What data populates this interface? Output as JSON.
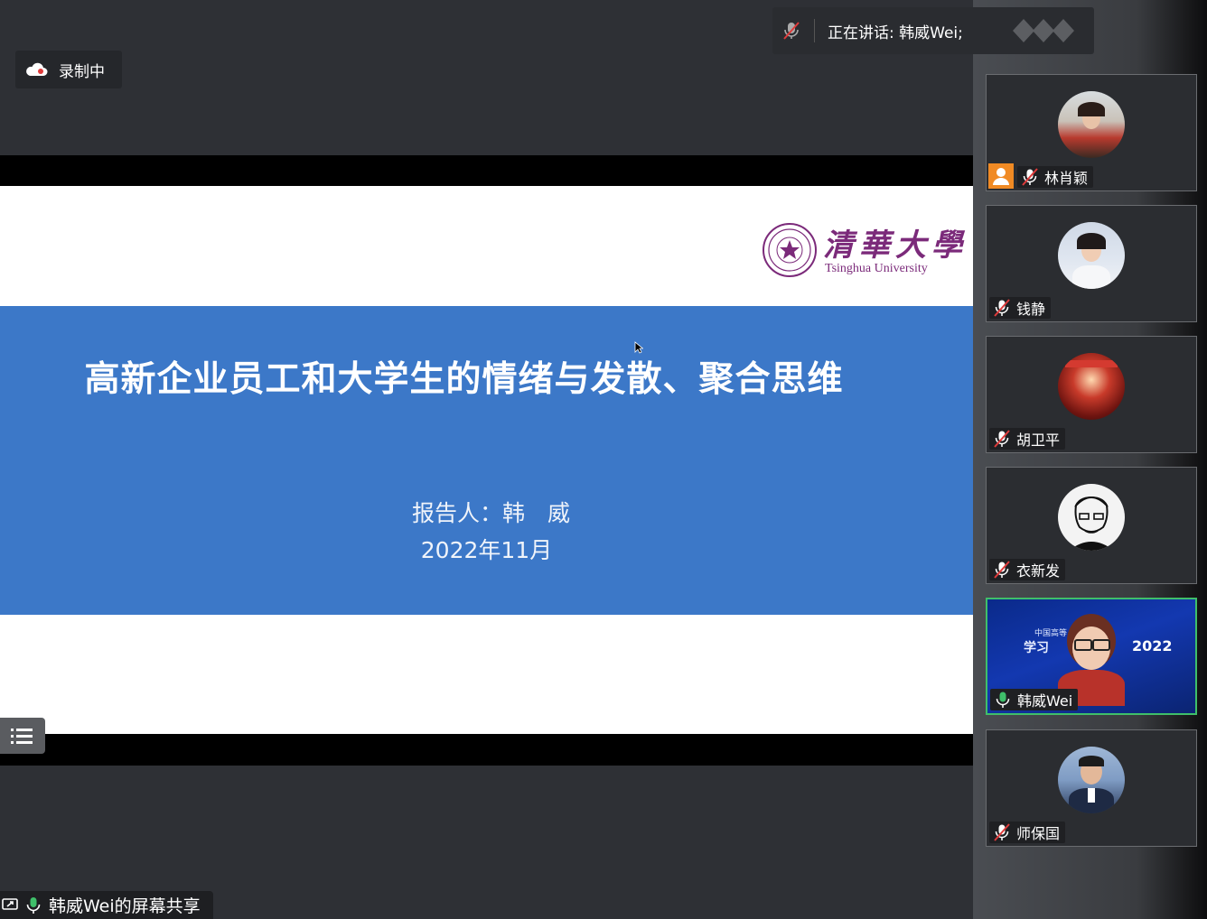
{
  "speaking": {
    "text": "正在讲话: 韩威Wei;"
  },
  "recording": {
    "label": "录制中"
  },
  "slide": {
    "logo_text": "清華大學",
    "logo_english": "Tsinghua University",
    "title": "高新企业员工和大学生的情绪与发散、聚合思维",
    "presenter": "报告人：韩　威",
    "date": "2022年11月"
  },
  "screen_share": {
    "label": "韩威Wei的屏幕共享"
  },
  "participants": [
    {
      "name": "林肖颖",
      "muted": true,
      "host": true
    },
    {
      "name": "钱静",
      "muted": true
    },
    {
      "name": "胡卫平",
      "muted": true
    },
    {
      "name": "衣新发",
      "muted": true
    },
    {
      "name": "韩威Wei",
      "muted": false,
      "active": true,
      "background_text": [
        "中国高等",
        "学习",
        "2022"
      ]
    },
    {
      "name": "师保国",
      "muted": true
    }
  ],
  "colors": {
    "slide_band": "#3c78c8",
    "accent_speaking": "#3fbf6a",
    "host_badge": "#f08a24"
  }
}
